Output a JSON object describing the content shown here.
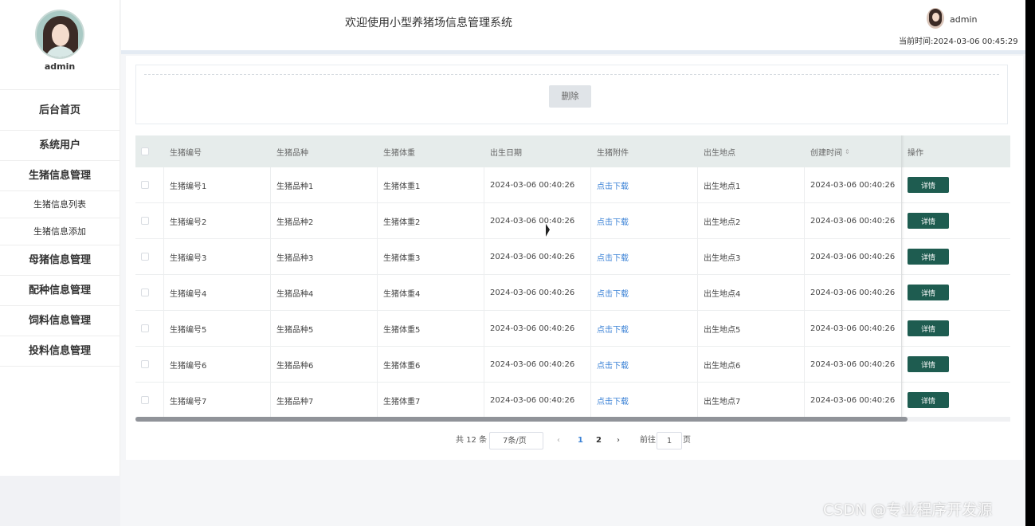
{
  "sidebar": {
    "username": "admin",
    "items": [
      {
        "label": "后台首页",
        "level": 1
      },
      {
        "label": "系统用户",
        "level": 1
      },
      {
        "label": "生猪信息管理",
        "level": 1
      },
      {
        "label": "生猪信息列表",
        "level": 2
      },
      {
        "label": "生猪信息添加",
        "level": 2
      },
      {
        "label": "母猪信息管理",
        "level": 1
      },
      {
        "label": "配种信息管理",
        "level": 1
      },
      {
        "label": "饲料信息管理",
        "level": 1
      },
      {
        "label": "投料信息管理",
        "level": 1
      }
    ]
  },
  "header": {
    "title": "欢迎使用小型养猪场信息管理系统",
    "username": "admin",
    "time_label": "当前时间:",
    "time_value": "2024-03-06 00:45:29"
  },
  "toolbar": {
    "delete_label": "删除"
  },
  "table": {
    "columns": [
      "生猪编号",
      "生猪品种",
      "生猪体重",
      "出生日期",
      "生猪附件",
      "出生地点",
      "创建时间",
      "操作"
    ],
    "sort_icon": "⇕",
    "rows": [
      {
        "id": "生猪编号1",
        "breed": "生猪品种1",
        "weight": "生猪体重1",
        "birth": "2024-03-06 00:40:26",
        "attach": "点击下载",
        "place": "出生地点1",
        "created": "2024-03-06 00:40:26",
        "action": "详情"
      },
      {
        "id": "生猪编号2",
        "breed": "生猪品种2",
        "weight": "生猪体重2",
        "birth": "2024-03-06 00:40:26",
        "attach": "点击下载",
        "place": "出生地点2",
        "created": "2024-03-06 00:40:26",
        "action": "详情"
      },
      {
        "id": "生猪编号3",
        "breed": "生猪品种3",
        "weight": "生猪体重3",
        "birth": "2024-03-06 00:40:26",
        "attach": "点击下载",
        "place": "出生地点3",
        "created": "2024-03-06 00:40:26",
        "action": "详情"
      },
      {
        "id": "生猪编号4",
        "breed": "生猪品种4",
        "weight": "生猪体重4",
        "birth": "2024-03-06 00:40:26",
        "attach": "点击下载",
        "place": "出生地点4",
        "created": "2024-03-06 00:40:26",
        "action": "详情"
      },
      {
        "id": "生猪编号5",
        "breed": "生猪品种5",
        "weight": "生猪体重5",
        "birth": "2024-03-06 00:40:26",
        "attach": "点击下载",
        "place": "出生地点5",
        "created": "2024-03-06 00:40:26",
        "action": "详情"
      },
      {
        "id": "生猪编号6",
        "breed": "生猪品种6",
        "weight": "生猪体重6",
        "birth": "2024-03-06 00:40:26",
        "attach": "点击下载",
        "place": "出生地点6",
        "created": "2024-03-06 00:40:26",
        "action": "详情"
      },
      {
        "id": "生猪编号7",
        "breed": "生猪品种7",
        "weight": "生猪体重7",
        "birth": "2024-03-06 00:40:26",
        "attach": "点击下载",
        "place": "出生地点7",
        "created": "2024-03-06 00:40:26",
        "action": "详情"
      }
    ]
  },
  "pagination": {
    "total": "共 12 条",
    "page_size": "7条/页",
    "prev": "‹",
    "pages": [
      "1",
      "2"
    ],
    "current": "1",
    "next": "›",
    "goto_label": "前往",
    "goto_value": "1",
    "page_suffix": "页"
  },
  "watermark": "CSDN @专业程序开发源",
  "colors": {
    "accent": "#1e5c50",
    "link": "#3b82d6",
    "table_header": "#e6eceb"
  }
}
